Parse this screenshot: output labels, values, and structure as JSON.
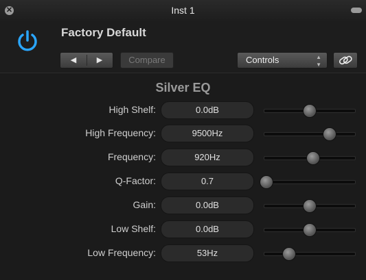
{
  "window": {
    "title": "Inst 1"
  },
  "header": {
    "preset_name": "Factory Default",
    "prev_label": "◀",
    "next_label": "▶",
    "compare_label": "Compare",
    "view_menu": {
      "selected": "Controls"
    }
  },
  "plugin": {
    "name": "Silver EQ"
  },
  "params": [
    {
      "label": "High Shelf:",
      "value": "0.0dB",
      "slider_fraction": 0.5
    },
    {
      "label": "High Frequency:",
      "value": "9500Hz",
      "slider_fraction": 0.72
    },
    {
      "label": "Frequency:",
      "value": "920Hz",
      "slider_fraction": 0.54
    },
    {
      "label": "Q-Factor:",
      "value": "0.7",
      "slider_fraction": 0.02
    },
    {
      "label": "Gain:",
      "value": "0.0dB",
      "slider_fraction": 0.5
    },
    {
      "label": "Low Shelf:",
      "value": "0.0dB",
      "slider_fraction": 0.5
    },
    {
      "label": "Low Frequency:",
      "value": "53Hz",
      "slider_fraction": 0.27
    }
  ],
  "colors": {
    "power_accent": "#2aa6ff"
  }
}
